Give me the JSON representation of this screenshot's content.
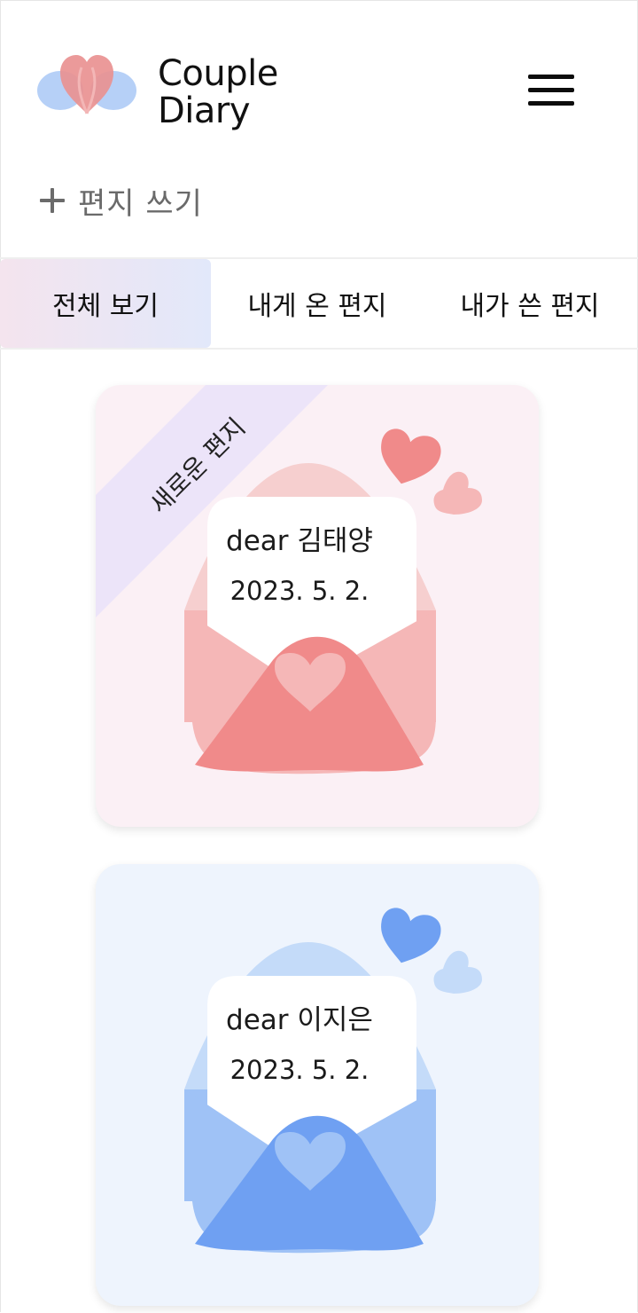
{
  "app": {
    "logo_line1": "Couple",
    "logo_line2": "Diary"
  },
  "header": {
    "menu_icon": "hamburger-menu-icon"
  },
  "actions": {
    "write_label": "편지 쓰기",
    "write_icon": "plus-icon"
  },
  "tabs": [
    {
      "label": "전체 보기",
      "active": true
    },
    {
      "label": "내게 온 편지",
      "active": false
    },
    {
      "label": "내가 쓴 편지",
      "active": false
    }
  ],
  "letters": [
    {
      "ribbon": "새로운 편지",
      "dear": "dear 김태양",
      "date": "2023. 5. 2.",
      "theme": "pink"
    },
    {
      "ribbon": "",
      "dear": "dear 이지은",
      "date": "2023. 5. 2.",
      "theme": "blue"
    }
  ],
  "colors": {
    "pink_card_bg": "#fbf0f5",
    "pink_envelope": "#f08a8a",
    "pink_envelope_light": "#f5b7b7",
    "blue_card_bg": "#eef4fd",
    "blue_envelope": "#6fa0f2",
    "blue_envelope_light": "#9fc2f6",
    "ribbon_bg": "#ece4f9",
    "active_tab_from": "#f4e4ee",
    "active_tab_to": "#e2e8fa"
  }
}
